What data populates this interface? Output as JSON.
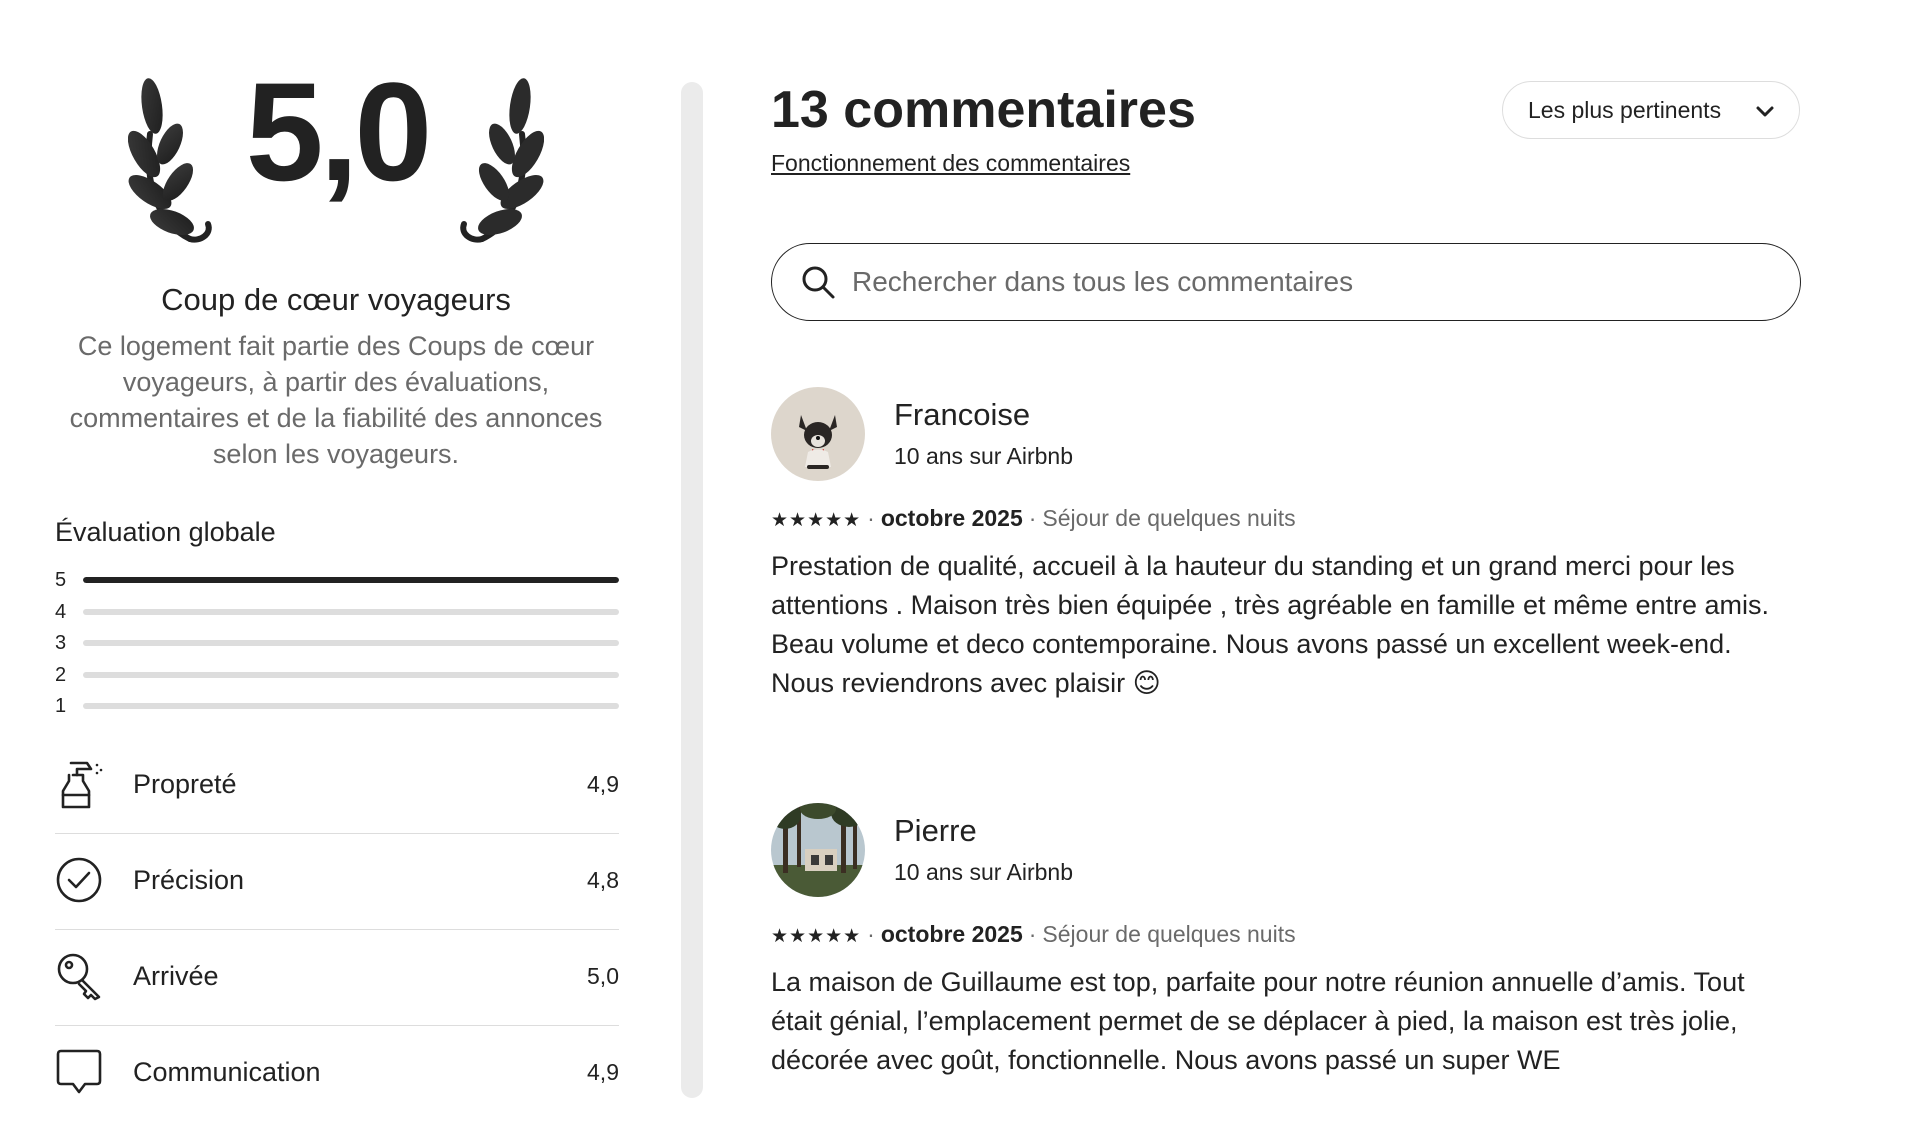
{
  "overall": {
    "score": "5,0",
    "badge_title": "Coup de cœur voyageurs",
    "badge_description": "Ce logement fait partie des Coups de cœur voyageurs, à partir des évaluations, commentaires et de la fiabilité des annonces selon les voyageurs."
  },
  "rating_distribution": {
    "title": "Évaluation globale",
    "bars": [
      {
        "label": "5",
        "fraction": 1.0
      },
      {
        "label": "4",
        "fraction": 0.0
      },
      {
        "label": "3",
        "fraction": 0.0
      },
      {
        "label": "2",
        "fraction": 0.0
      },
      {
        "label": "1",
        "fraction": 0.0
      }
    ]
  },
  "categories": [
    {
      "label": "Propreté",
      "value": "4,9",
      "icon": "spray-bottle-icon"
    },
    {
      "label": "Précision",
      "value": "4,8",
      "icon": "check-circle-icon"
    },
    {
      "label": "Arrivée",
      "value": "5,0",
      "icon": "key-icon"
    },
    {
      "label": "Communication",
      "value": "4,9",
      "icon": "chat-bubble-icon"
    }
  ],
  "reviews_header": {
    "count_title": "13 commentaires",
    "how_link": "Fonctionnement des commentaires",
    "sort_label": "Les plus pertinents"
  },
  "search": {
    "placeholder": "Rechercher dans tous les commentaires",
    "value": ""
  },
  "reviews": [
    {
      "name": "Francoise",
      "tenure": "10 ans sur Airbnb",
      "stars": "★★★★★",
      "rating": 5,
      "date": "octobre 2025",
      "stay": "Séjour de quelques nuits",
      "text_lines": [
        "Prestation de qualité, accueil à la hauteur du standing et un grand merci pour les attentions . Maison très bien équipée , très agréable en famille et même entre amis. Beau volume et deco contemporaine. Nous avons passé un excellent week-end.",
        "Nous reviendrons avec plaisir 😊"
      ],
      "avatar": "dog-avatar"
    },
    {
      "name": "Pierre",
      "tenure": "10 ans sur Airbnb",
      "stars": "★★★★★",
      "rating": 5,
      "date": "octobre 2025",
      "stay": "Séjour de quelques nuits",
      "text_lines": [
        "La maison de Guillaume est top, parfaite pour notre réunion annuelle d’amis. Tout était génial, l’emplacement permet de se déplacer à pied, la maison est très jolie, décorée avec goût, fonctionnelle. Nous avons passé un super WE"
      ],
      "avatar": "house-trees-avatar"
    }
  ],
  "colors": {
    "text": "#222222",
    "muted": "#6a6a6a",
    "border": "#dddddd",
    "divider": "#ebebeb"
  }
}
